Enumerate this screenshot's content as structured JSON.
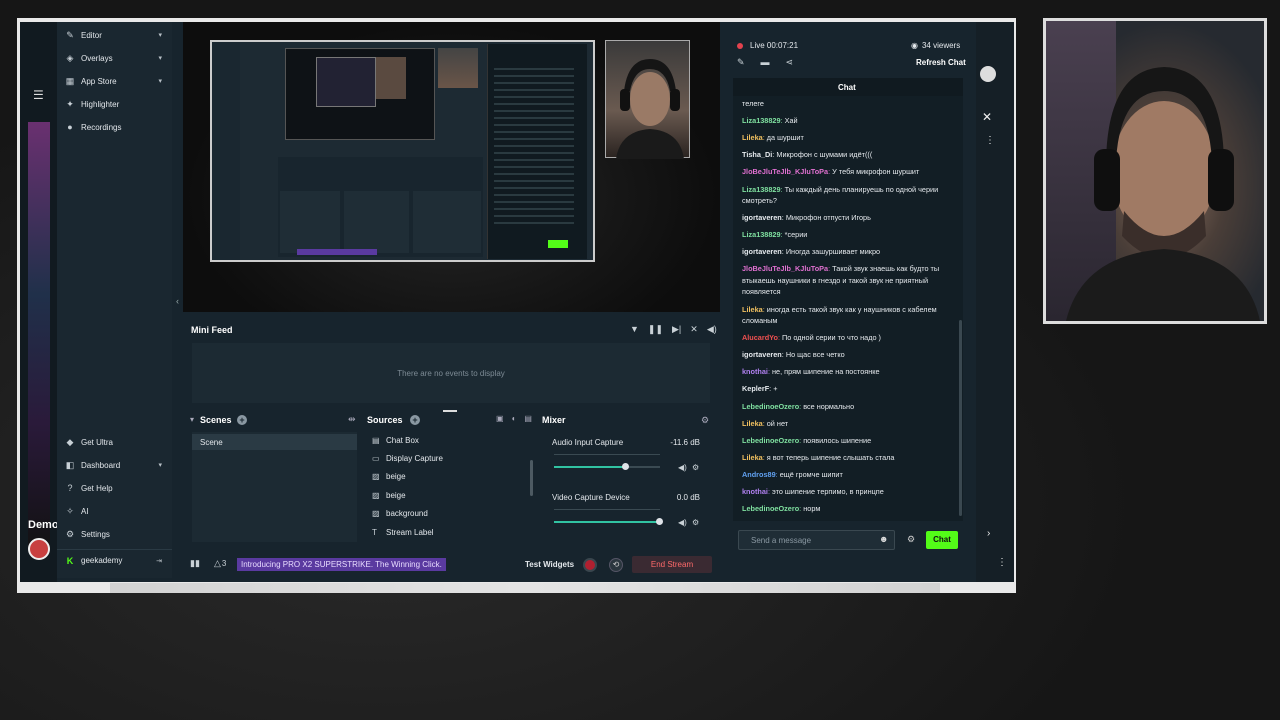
{
  "sidebar": {
    "items": [
      {
        "label": "Editor",
        "icon": "pencil-icon",
        "chev": true
      },
      {
        "label": "Overlays",
        "icon": "layers-icon",
        "chev": true
      },
      {
        "label": "App Store",
        "icon": "store-icon",
        "chev": true
      },
      {
        "label": "Highlighter",
        "icon": "highlighter-icon",
        "chev": false
      },
      {
        "label": "Recordings",
        "icon": "record-icon",
        "chev": false
      }
    ],
    "bottom_items": [
      {
        "label": "Get Ultra",
        "icon": "ultra-icon",
        "chev": false
      },
      {
        "label": "Dashboard",
        "icon": "dashboard-icon",
        "chev": true
      },
      {
        "label": "Get Help",
        "icon": "help-icon",
        "chev": false
      },
      {
        "label": "AI",
        "icon": "ai-icon",
        "chev": false
      },
      {
        "label": "Settings",
        "icon": "gear-icon",
        "chev": false
      }
    ],
    "account": "geekademy",
    "under_text": "Demo"
  },
  "minifeed": {
    "title": "Mini Feed",
    "empty": "There are no events to display"
  },
  "scenes": {
    "title": "Scenes",
    "items": [
      "Scene"
    ]
  },
  "sources": {
    "title": "Sources",
    "items": [
      {
        "label": "Chat Box",
        "icon": "folder-icon"
      },
      {
        "label": "Display Capture",
        "icon": "monitor-icon"
      },
      {
        "label": "beige",
        "icon": "image-icon"
      },
      {
        "label": "beige",
        "icon": "image-icon"
      },
      {
        "label": "background",
        "icon": "image-icon"
      },
      {
        "label": "Stream Label",
        "icon": "text-icon"
      }
    ]
  },
  "mixer": {
    "title": "Mixer",
    "channels": [
      {
        "name": "Audio Input Capture",
        "level": "-11.6 dB",
        "volume": 0.68
      },
      {
        "name": "Video Capture Device",
        "level": "0.0 dB",
        "volume": 1.0
      }
    ]
  },
  "footer": {
    "alerts": "3",
    "promo": "Introducing PRO X2 SUPERSTRIKE. The Winning Click.",
    "test_widgets": "Test Widgets",
    "end_stream": "End Stream"
  },
  "chat": {
    "live": "Live 00:07:21",
    "viewers": "34 viewers",
    "refresh": "Refresh Chat",
    "title": "Chat",
    "input_placeholder": "Send a message",
    "send": "Chat",
    "messages": [
      {
        "user": "",
        "color": "#e6eaee",
        "text": "телеге"
      },
      {
        "user": "Liza138829",
        "color": "#7fe0a0",
        "text": "Хай"
      },
      {
        "user": "Lileka",
        "color": "#f0c060",
        "text": "да шуршит"
      },
      {
        "user": "Tisha_Di",
        "color": "#e6eaee",
        "text": "Микрофон с шумами идёт((("
      },
      {
        "user": "JloBeJluTeJlb_KJluToPa",
        "color": "#e070d0",
        "text": "У тебя микрофон шуршит"
      },
      {
        "user": "Liza138829",
        "color": "#7fe0a0",
        "text": "Ты каждый день планируешь по одной черии смотреть?"
      },
      {
        "user": "igortaveren",
        "color": "#e6eaee",
        "text": "Микрофон отпусти Игорь"
      },
      {
        "user": "Liza138829",
        "color": "#7fe0a0",
        "text": "*серии"
      },
      {
        "user": "igortaveren",
        "color": "#e6eaee",
        "text": "Иногда зашуршивает микро"
      },
      {
        "user": "JloBeJluTeJlb_KJluToPa",
        "color": "#e070d0",
        "text": "Такой звук знаешь как будто ты втыкаешь наушники в гнездо и такой звук не приятный появляется"
      },
      {
        "user": "Lileka",
        "color": "#f0c060",
        "text": "иногда есть такой звук как у наушников с кабелем сломаным"
      },
      {
        "user": "AlucardYo",
        "color": "#f05050",
        "text": "По одной серии то что надо )"
      },
      {
        "user": "igortaveren",
        "color": "#e6eaee",
        "text": "Но щас все четко"
      },
      {
        "user": "knothai",
        "color": "#b080f0",
        "text": "не, прям шипение на постоянке"
      },
      {
        "user": "KeplerF",
        "color": "#e6eaee",
        "text": "+"
      },
      {
        "user": "LebedinoeOzero",
        "color": "#7fe0a0",
        "text": "все нормально"
      },
      {
        "user": "Lileka",
        "color": "#f0c060",
        "text": "ой нет"
      },
      {
        "user": "LebedinoeOzero",
        "color": "#7fe0a0",
        "text": "появилось шипение"
      },
      {
        "user": "Lileka",
        "color": "#f0c060",
        "text": "я вот теперь шипение слышать стала"
      },
      {
        "user": "Andros89",
        "color": "#60a0f0",
        "text": "ещё громче шипит"
      },
      {
        "user": "knothai",
        "color": "#b080f0",
        "text": "это шипение терпимо, в принцпе"
      },
      {
        "user": "LebedinoeOzero",
        "color": "#7fe0a0",
        "text": "норм"
      }
    ]
  },
  "colors": {
    "accent": "#31c3a2",
    "live": "#e3424e",
    "send": "#53fc18",
    "promo": "#5a3aa0"
  }
}
